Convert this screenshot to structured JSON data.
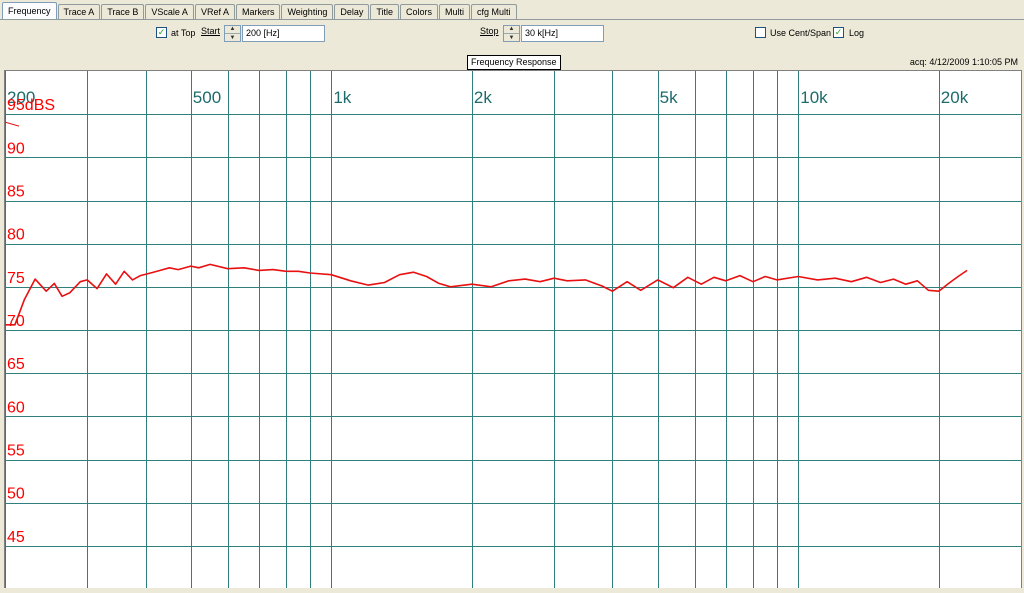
{
  "tabs": [
    {
      "label": "Frequency",
      "active": true
    },
    {
      "label": "Trace A",
      "active": false
    },
    {
      "label": "Trace B",
      "active": false
    },
    {
      "label": "VScale A",
      "active": false
    },
    {
      "label": "VRef A",
      "active": false
    },
    {
      "label": "Markers",
      "active": false
    },
    {
      "label": "Weighting",
      "active": false
    },
    {
      "label": "Delay",
      "active": false
    },
    {
      "label": "Title",
      "active": false
    },
    {
      "label": "Colors",
      "active": false
    },
    {
      "label": "Multi",
      "active": false
    },
    {
      "label": "cfg Multi",
      "active": false
    }
  ],
  "controls": {
    "at_top": {
      "label": "at Top",
      "checked": true
    },
    "start": {
      "label": "Start",
      "value": "200 [Hz]"
    },
    "stop": {
      "label": "Stop",
      "value": "30 k[Hz]"
    },
    "use_cent_span": {
      "label": "Use Cent/Span",
      "checked": false
    },
    "log": {
      "label": "Log",
      "checked": true
    }
  },
  "header": {
    "title": "Frequency Response",
    "acquired": "acq: 4/12/2009 1:10:05 PM"
  },
  "colors": {
    "grid": "#2f7f7f",
    "trace": "#e81010",
    "label_x": "#1d6b6b",
    "label_y": "#ff0000"
  },
  "chart_data": {
    "type": "line",
    "x_scale": "log",
    "xlim": [
      200,
      30000
    ],
    "ylim": [
      40,
      100
    ],
    "x_ticks": [
      {
        "value": 200,
        "label": "200"
      },
      {
        "value": 500,
        "label": "500"
      },
      {
        "value": 1000,
        "label": "1k"
      },
      {
        "value": 2000,
        "label": "2k"
      },
      {
        "value": 5000,
        "label": "5k"
      },
      {
        "value": 10000,
        "label": "10k"
      },
      {
        "value": 20000,
        "label": "20k"
      }
    ],
    "x_grid": [
      200,
      300,
      400,
      500,
      600,
      700,
      800,
      900,
      1000,
      2000,
      3000,
      4000,
      5000,
      6000,
      7000,
      8000,
      9000,
      10000,
      20000
    ],
    "y_ticks": [
      {
        "value": 95,
        "label": "95dBS"
      },
      {
        "value": 90,
        "label": "90"
      },
      {
        "value": 85,
        "label": "85"
      },
      {
        "value": 80,
        "label": "80"
      },
      {
        "value": 75,
        "label": "75"
      },
      {
        "value": 70,
        "label": "70"
      },
      {
        "value": 65,
        "label": "65"
      },
      {
        "value": 60,
        "label": "60"
      },
      {
        "value": 55,
        "label": "55"
      },
      {
        "value": 50,
        "label": "50"
      },
      {
        "value": 45,
        "label": "45"
      }
    ],
    "grid": true,
    "series": [
      {
        "x": [
          200,
          210,
          220,
          232,
          245,
          255,
          265,
          275,
          290,
          300,
          315,
          330,
          345,
          360,
          375,
          390,
          410,
          430,
          450,
          470,
          500,
          520,
          550,
          600,
          650,
          700,
          750,
          800,
          850,
          900,
          1000,
          1100,
          1200,
          1300,
          1400,
          1500,
          1600,
          1700,
          1800,
          2000,
          2200,
          2400,
          2600,
          2800,
          3000,
          3200,
          3500,
          3800,
          4000,
          4300,
          4600,
          5000,
          5400,
          5800,
          6200,
          6600,
          7000,
          7500,
          8000,
          8500,
          9000,
          10000,
          11000,
          12000,
          13000,
          14000,
          15000,
          16000,
          17000,
          18000,
          19000,
          20000,
          21000,
          22000,
          23000
        ],
        "y": [
          70.6,
          70.6,
          73.5,
          75.9,
          74.5,
          75.4,
          73.9,
          74.3,
          75.6,
          75.8,
          74.8,
          76.5,
          75.3,
          76.8,
          75.8,
          76.3,
          76.6,
          76.9,
          77.2,
          77.0,
          77.4,
          77.2,
          77.6,
          77.1,
          77.2,
          76.9,
          77.0,
          76.8,
          76.8,
          76.6,
          76.4,
          75.7,
          75.2,
          75.5,
          76.4,
          76.7,
          76.2,
          75.4,
          75.0,
          75.3,
          75.0,
          75.7,
          75.9,
          75.6,
          76.0,
          75.7,
          75.8,
          75.1,
          74.5,
          75.6,
          74.6,
          75.8,
          74.9,
          76.1,
          75.3,
          76.1,
          75.7,
          76.3,
          75.6,
          76.2,
          75.8,
          76.2,
          75.8,
          76.0,
          75.6,
          76.1,
          75.5,
          75.9,
          75.3,
          75.7,
          74.6,
          74.5,
          75.4,
          76.2,
          76.9
        ]
      }
    ]
  }
}
